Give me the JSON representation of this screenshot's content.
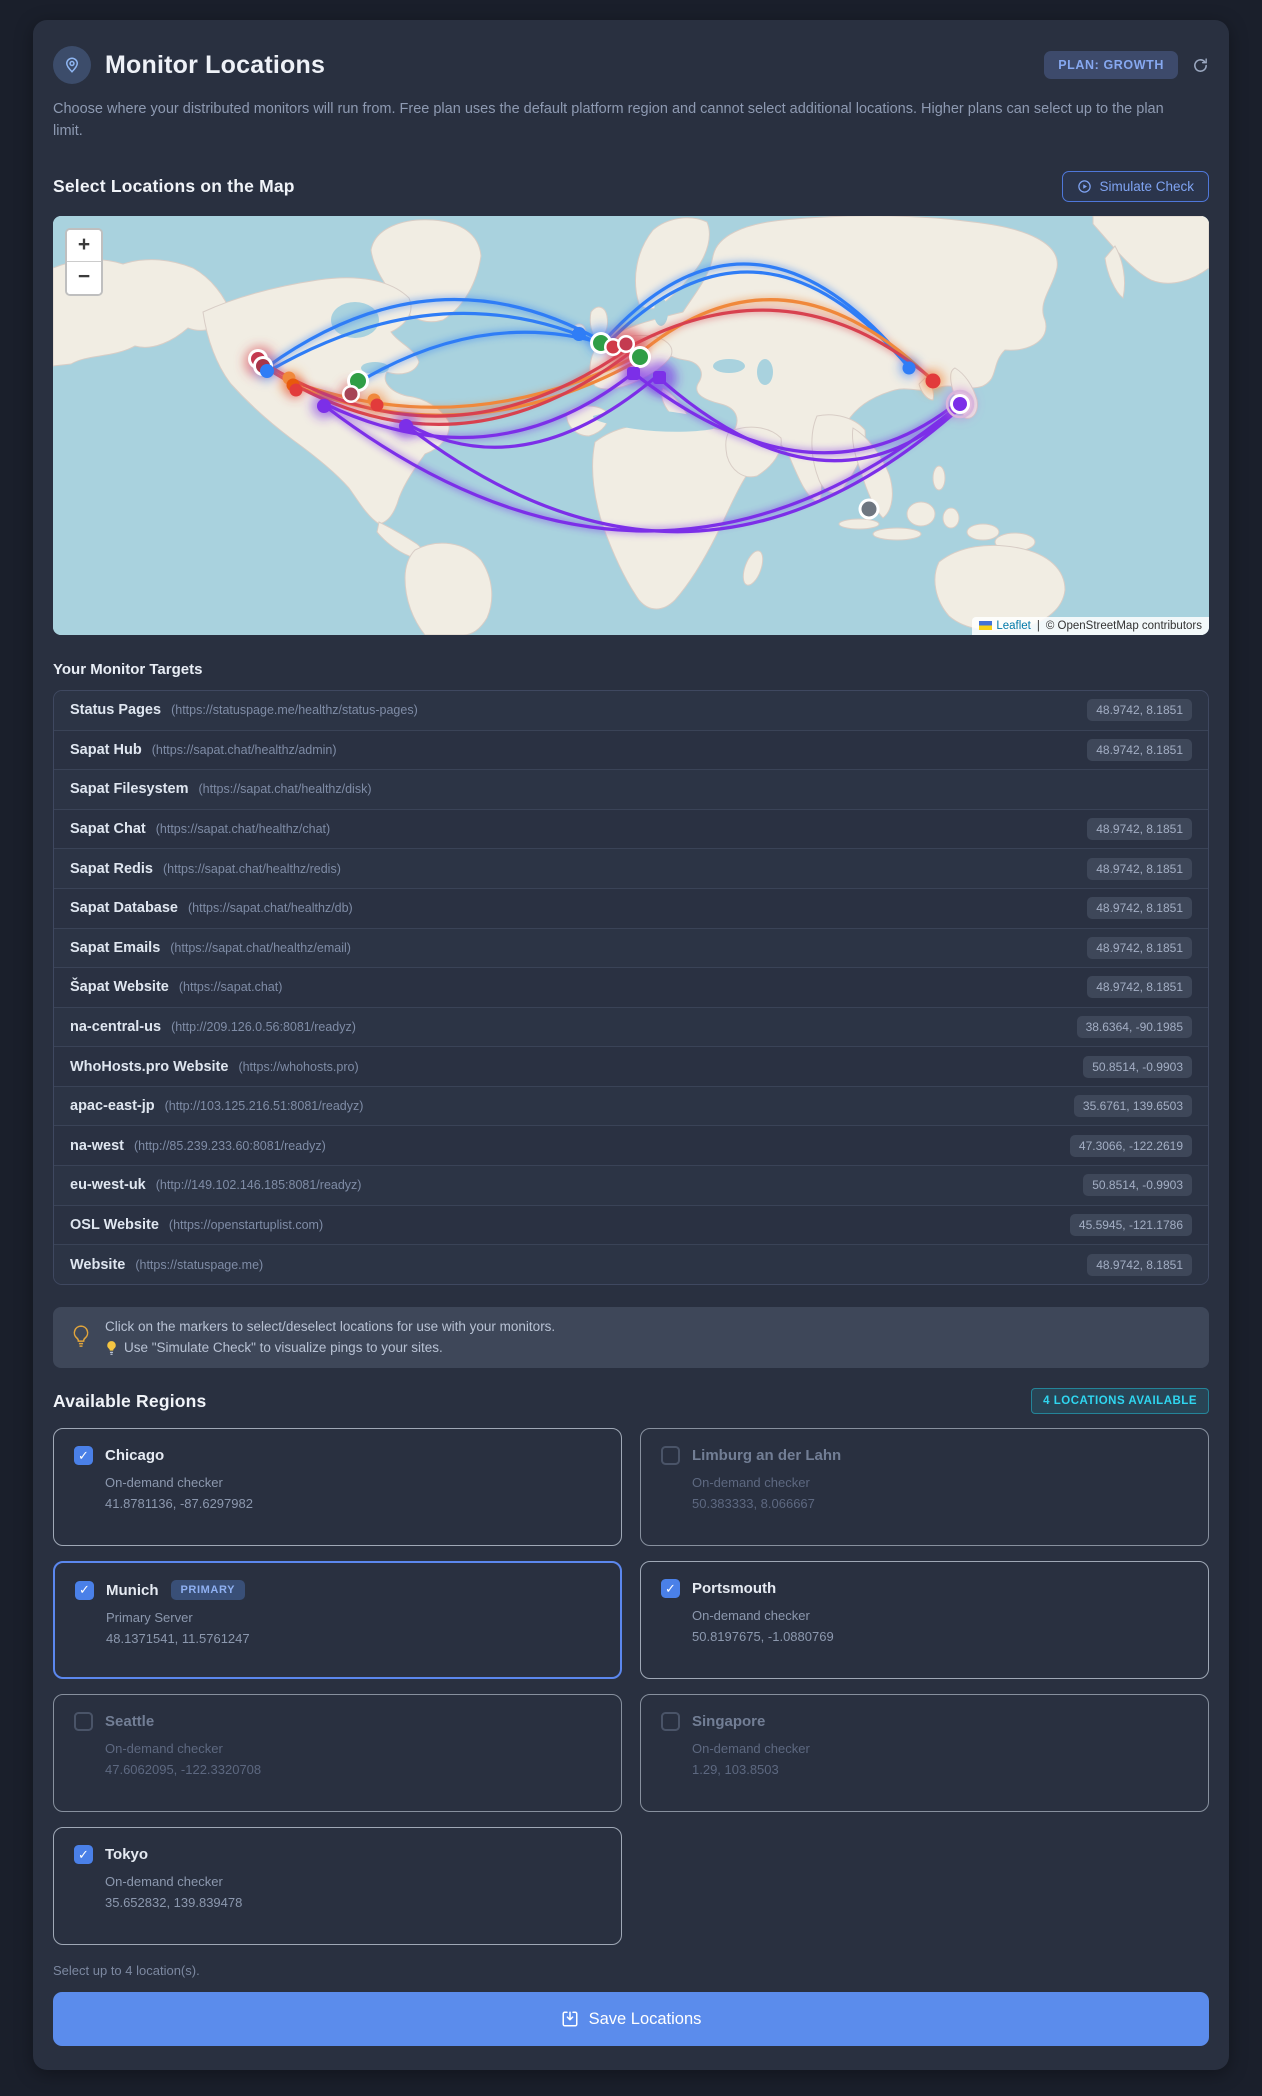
{
  "header": {
    "title": "Monitor Locations",
    "plan_badge": "PLAN: GROWTH",
    "description": "Choose where your distributed monitors will run from. Free plan uses the default platform region and cannot select additional locations. Higher plans can select up to the plan limit."
  },
  "map_section": {
    "heading": "Select Locations on the Map",
    "simulate_button": "Simulate Check",
    "zoom_in": "+",
    "zoom_out": "−",
    "attribution": {
      "leaflet": "Leaflet",
      "separator": "|",
      "osm": "© OpenStreetMap contributors"
    }
  },
  "targets": {
    "heading": "Your Monitor Targets",
    "rows": [
      {
        "name": "Status Pages",
        "url": "(https://statuspage.me/healthz/status-pages)",
        "coords": "48.9742, 8.1851"
      },
      {
        "name": "Sapat Hub",
        "url": "(https://sapat.chat/healthz/admin)",
        "coords": "48.9742, 8.1851"
      },
      {
        "name": "Sapat Filesystem",
        "url": "(https://sapat.chat/healthz/disk)",
        "coords": ""
      },
      {
        "name": "Sapat Chat",
        "url": "(https://sapat.chat/healthz/chat)",
        "coords": "48.9742, 8.1851"
      },
      {
        "name": "Sapat Redis",
        "url": "(https://sapat.chat/healthz/redis)",
        "coords": "48.9742, 8.1851"
      },
      {
        "name": "Sapat Database",
        "url": "(https://sapat.chat/healthz/db)",
        "coords": "48.9742, 8.1851"
      },
      {
        "name": "Sapat Emails",
        "url": "(https://sapat.chat/healthz/email)",
        "coords": "48.9742, 8.1851"
      },
      {
        "name": "Šapat Website",
        "url": "(https://sapat.chat)",
        "coords": "48.9742, 8.1851"
      },
      {
        "name": "na-central-us",
        "url": "(http://209.126.0.56:8081/readyz)",
        "coords": "38.6364, -90.1985"
      },
      {
        "name": "WhoHosts.pro Website",
        "url": "(https://whohosts.pro)",
        "coords": "50.8514, -0.9903"
      },
      {
        "name": "apac-east-jp",
        "url": "(http://103.125.216.51:8081/readyz)",
        "coords": "35.6761, 139.6503"
      },
      {
        "name": "na-west",
        "url": "(http://85.239.233.60:8081/readyz)",
        "coords": "47.3066, -122.2619"
      },
      {
        "name": "eu-west-uk",
        "url": "(http://149.102.146.185:8081/readyz)",
        "coords": "50.8514, -0.9903"
      },
      {
        "name": "OSL Website",
        "url": "(https://openstartuplist.com)",
        "coords": "45.5945, -121.1786"
      },
      {
        "name": "Website",
        "url": "(https://statuspage.me)",
        "coords": "48.9742, 8.1851"
      }
    ]
  },
  "tip": {
    "line1": "Click on the markers to select/deselect locations for use with your monitors.",
    "line2": "Use \"Simulate Check\" to visualize pings to your sites."
  },
  "regions": {
    "heading": "Available Regions",
    "badge": "4 LOCATIONS AVAILABLE",
    "cards": [
      {
        "name": "Chicago",
        "type": "On-demand checker",
        "coords": "41.8781136, -87.6297982",
        "checked": true
      },
      {
        "name": "Limburg an der Lahn",
        "type": "On-demand checker",
        "coords": "50.383333, 8.066667",
        "checked": false
      },
      {
        "name": "Munich",
        "badge": "PRIMARY",
        "type": "Primary Server",
        "coords": "48.1371541, 11.5761247",
        "checked": true
      },
      {
        "name": "Portsmouth",
        "type": "On-demand checker",
        "coords": "50.8197675, -1.0880769",
        "checked": true
      },
      {
        "name": "Seattle",
        "type": "On-demand checker",
        "coords": "47.6062095, -122.3320708",
        "checked": false
      },
      {
        "name": "Singapore",
        "type": "On-demand checker",
        "coords": "1.29, 103.8503",
        "checked": false
      },
      {
        "name": "Tokyo",
        "type": "On-demand checker",
        "coords": "35.652832, 139.839478",
        "checked": true
      }
    ],
    "limit_note": "Select up to 4 location(s)."
  },
  "save_button": "Save Locations",
  "icons": {
    "check_glyph": "✓"
  },
  "accent_colors": {
    "primary_blue": "#5b8cec",
    "badge_blue_text": "#86a8f0",
    "cyan_badge": "#2fd6f0",
    "arc_blue": "#2f7df6",
    "arc_orange": "#f0883b",
    "arc_crimson": "#d8414f",
    "arc_purple": "#7c2fe8",
    "map_land": "#f1ede3",
    "map_water": "#a9d2de"
  }
}
